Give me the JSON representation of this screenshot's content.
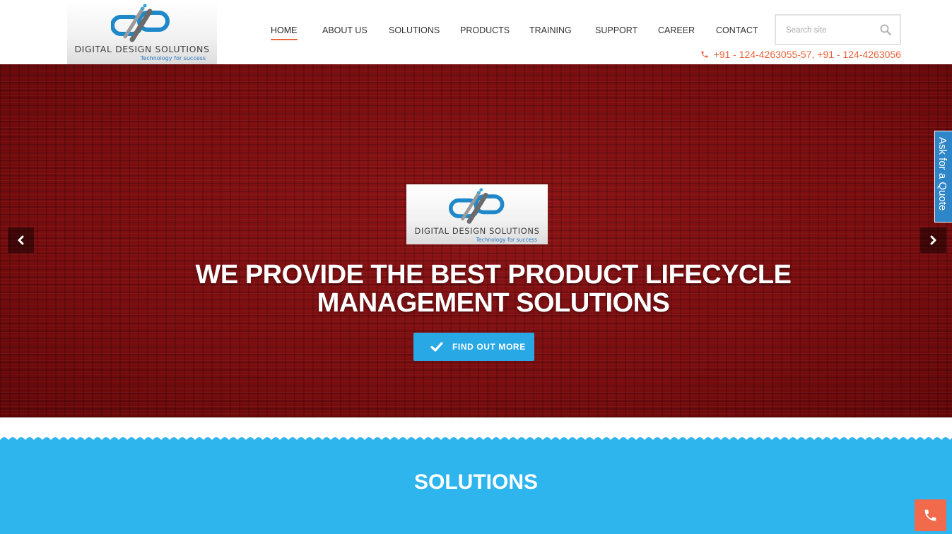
{
  "header": {
    "logo": {
      "name": "DIGITAL DESIGN SOLUTIONS",
      "tagline": "Technology for success"
    },
    "nav": [
      {
        "label": "HOME",
        "active": true
      },
      {
        "label": "ABOUT US",
        "active": false
      },
      {
        "label": "SOLUTIONS",
        "active": false
      },
      {
        "label": "PRODUCTS",
        "active": false
      },
      {
        "label": "TRAINING",
        "active": false
      },
      {
        "label": "SUPPORT",
        "active": false
      },
      {
        "label": "CAREER",
        "active": false
      },
      {
        "label": "CONTACT",
        "active": false
      }
    ],
    "search": {
      "placeholder": "Search site",
      "icon": "search-icon"
    },
    "phone": {
      "icon": "phone-icon",
      "text": "+91 - 124-4263055-57, +91 - 124-4263056"
    }
  },
  "hero": {
    "logo": {
      "name": "DIGITAL DESIGN SOLUTIONS",
      "tagline": "Technology for success"
    },
    "heading_line1": "WE PROVIDE THE BEST PRODUCT LIFECYCLE",
    "heading_line2": "MANAGEMENT SOLUTIONS",
    "cta": {
      "label": "FIND OUT MORE",
      "icon": "check-icon"
    },
    "prev_icon": "chevron-left-icon",
    "next_icon": "chevron-right-icon"
  },
  "quote_tab": {
    "label": "Ask for a Quote"
  },
  "solutions": {
    "title": "SOLUTIONS"
  },
  "call_button": {
    "icon": "phone-icon"
  },
  "colors": {
    "accent": "#e8643c",
    "hero_red": "#7d0e10",
    "cta_blue": "#29a8e6",
    "solutions_blue": "#2fb5ee",
    "quote_blue": "#2e86c8",
    "call_orange": "#f06a4b"
  }
}
